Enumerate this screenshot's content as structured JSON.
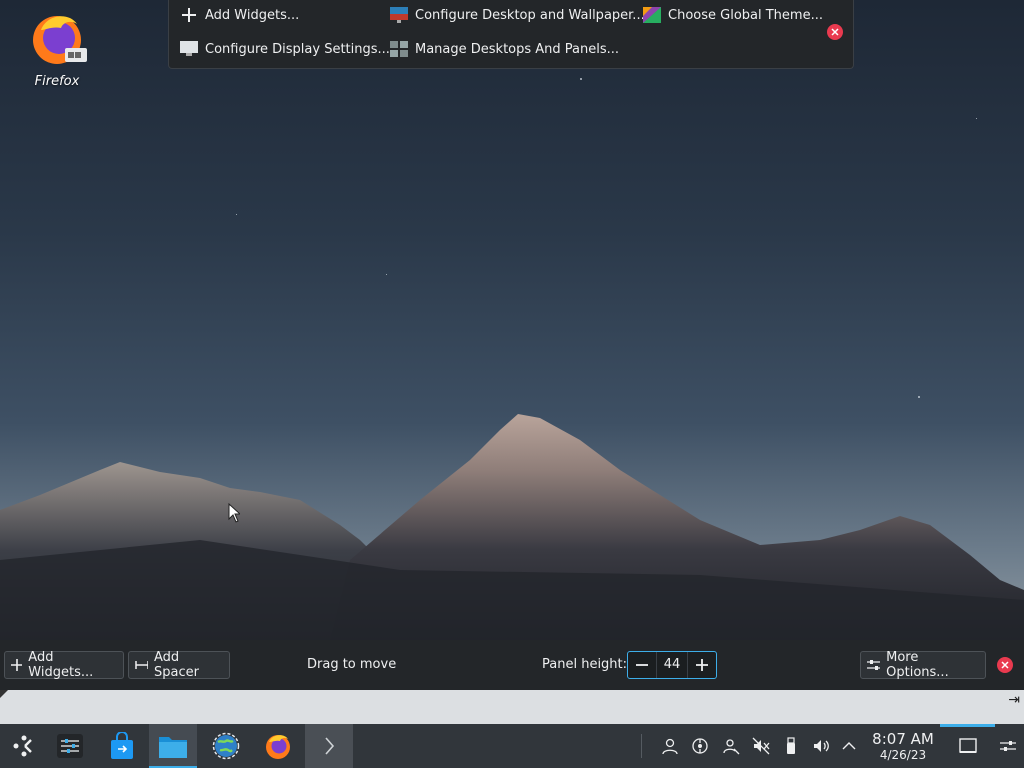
{
  "desktop": {
    "icons": [
      {
        "label": "Firefox",
        "icon": "firefox-icon"
      }
    ]
  },
  "top_toolbar": {
    "items": [
      {
        "label": "Add Widgets...",
        "icon": "plus-icon"
      },
      {
        "label": "Configure Desktop and Wallpaper...",
        "icon": "desktop-wallpaper-icon"
      },
      {
        "label": "Choose Global Theme...",
        "icon": "theme-icon"
      },
      {
        "label": "Configure Display Settings...",
        "icon": "display-icon"
      },
      {
        "label": "Manage Desktops And Panels...",
        "icon": "panels-icon"
      }
    ],
    "close_icon": "close-icon"
  },
  "panel_edit": {
    "add_widgets": "Add Widgets...",
    "add_spacer": "Add Spacer",
    "drag_hint": "Drag to move",
    "height_label": "Panel height:",
    "height_value": "44",
    "more_options": "More Options..."
  },
  "taskbar": {
    "launchers": [
      {
        "name": "application-launcher",
        "icon": "kde-launcher-icon"
      },
      {
        "name": "system-settings",
        "icon": "settings-sliders-icon"
      },
      {
        "name": "discover",
        "icon": "store-bag-icon"
      },
      {
        "name": "dolphin",
        "icon": "folder-icon"
      },
      {
        "name": "browser-globe",
        "icon": "globe-icon"
      },
      {
        "name": "firefox",
        "icon": "firefox-icon"
      },
      {
        "name": "konsole",
        "icon": "terminal-icon"
      }
    ],
    "tray": [
      "user-icon",
      "kde-connect-icon",
      "network-user-icon",
      "audio-muted-icon",
      "usb-device-icon",
      "volume-icon",
      "chevron-up-icon"
    ],
    "clock_time": "8:07 AM",
    "clock_date": "4/26/23"
  },
  "colors": {
    "accent": "#3daee9",
    "close": "#e93a4f",
    "panel": "#232629",
    "taskbar": "#31363b"
  }
}
